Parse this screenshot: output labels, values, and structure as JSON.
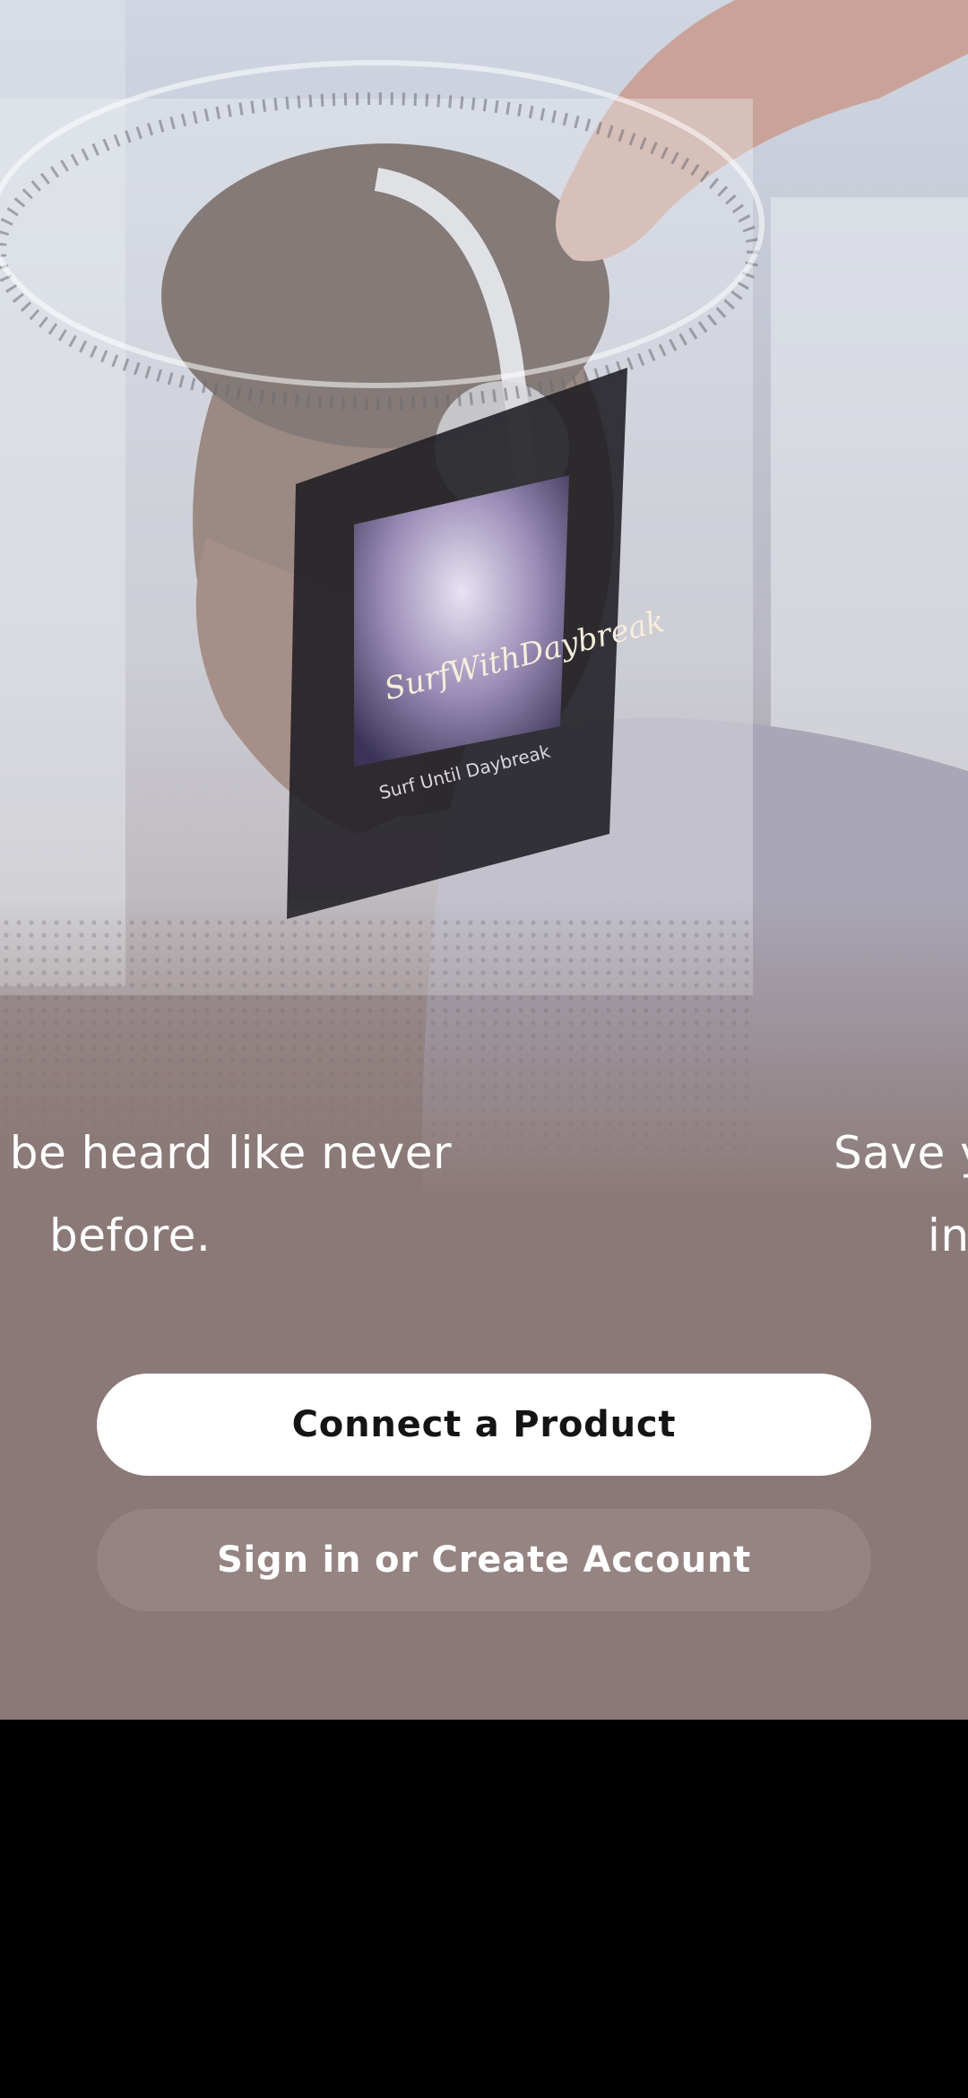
{
  "hero": {
    "product_screen_text": "Surf Until Daybreak",
    "album_script_text": "SurfWithDaybreak"
  },
  "carousel": {
    "current_caption_line1": "l be heard like never",
    "current_caption_line2": "before.",
    "next_caption_line1": "Save y",
    "next_caption_line2": "in"
  },
  "actions": {
    "connect_label": "Connect a Product",
    "signin_label": "Sign in or Create Account"
  },
  "colors": {
    "background": "#8b7977",
    "primary_button": "#ffffff",
    "secondary_button": "#958482"
  }
}
